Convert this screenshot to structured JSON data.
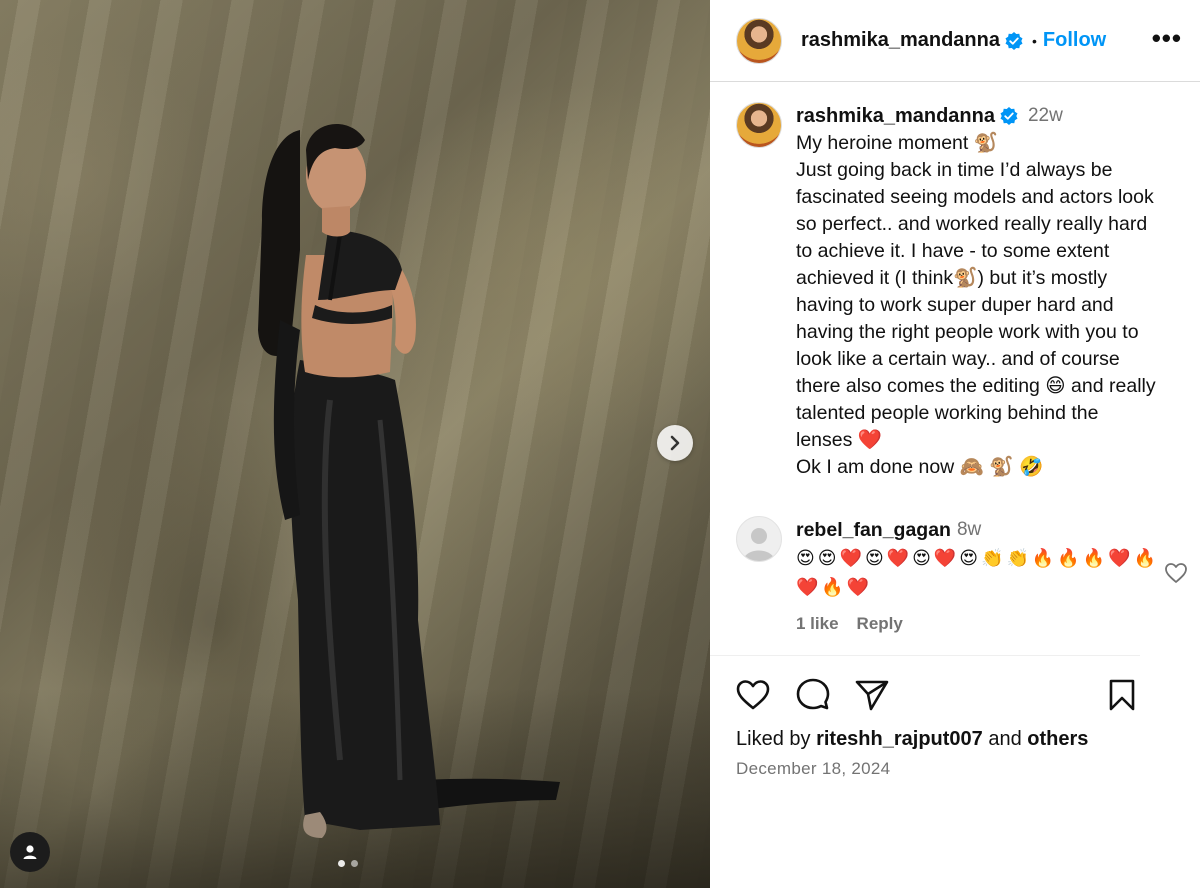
{
  "post": {
    "username": "rashmika_mandanna",
    "follow_label": "Follow",
    "separator": "•",
    "more_label": "•••"
  },
  "caption": {
    "username": "rashmika_mandanna",
    "time": "22w",
    "lines": [
      "My heroine moment 🐒",
      "Just going back in time I’d always be",
      "fascinated seeing models and actors look",
      "so perfect.. and worked really really hard",
      "to achieve it. I have - to some extent",
      "achieved it (I think🐒) but it’s mostly",
      "having to work super duper hard and",
      "having the right people work with you to",
      "look like a certain way.. and of course",
      "there also comes the editing 😄 and really",
      "talented people working behind the",
      "lenses ❤️",
      "Ok I am done now 🙈 🐒 🤣"
    ]
  },
  "comment": {
    "username": "rebel_fan_gagan",
    "time": "8w",
    "text": "😍😍❤️😍❤️😍❤️😍👏👏🔥🔥🔥❤️🔥❤️🔥❤️",
    "likes_label": "1 like",
    "reply_label": "Reply"
  },
  "footer": {
    "liked_prefix": "Liked by",
    "liked_user": "riteshh_rajput007",
    "liked_and": "and",
    "liked_others": "others",
    "date": "December 18, 2024"
  },
  "colors": {
    "accent": "#0095f6",
    "verified": "#0095f6",
    "muted": "#737373",
    "heart": "#ed1c24"
  },
  "icons": {
    "next": "chevron-right-icon",
    "like": "heart-icon",
    "comment": "comment-icon",
    "share": "send-icon",
    "save": "bookmark-icon",
    "more": "more-icon"
  },
  "carousel": {
    "slide_count": 2,
    "current_slide": 1
  }
}
